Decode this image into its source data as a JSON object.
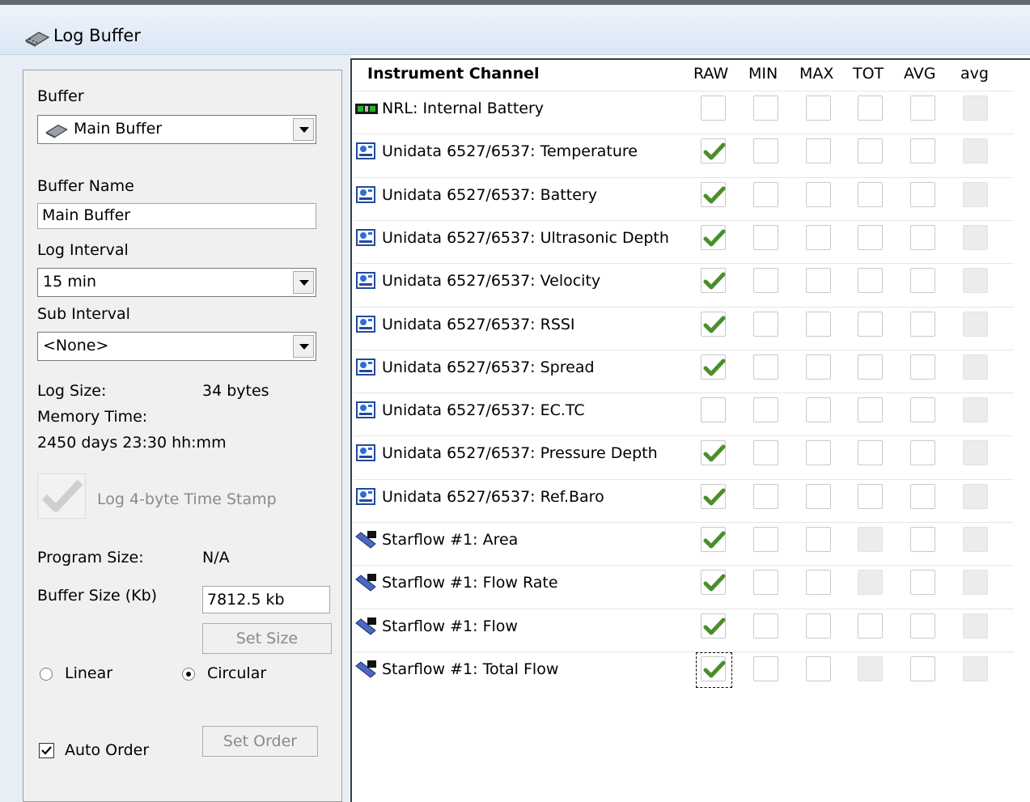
{
  "window": {
    "title": "Log Buffer",
    "icon": "memory-chip-icon"
  },
  "left": {
    "buffer_label": "Buffer",
    "buffer_value": "Main Buffer",
    "buffer_name_label": "Buffer Name",
    "buffer_name_value": "Main Buffer",
    "log_interval_label": "Log Interval",
    "log_interval_value": "15 min",
    "sub_interval_label": "Sub Interval",
    "sub_interval_value": "<None>",
    "log_size_label": "Log Size:",
    "log_size_value": "34 bytes",
    "memory_time_label": "Memory Time:",
    "memory_time_value": "2450 days 23:30 hh:mm",
    "timestamp_label": "Log 4-byte Time Stamp",
    "program_size_label": "Program Size:",
    "program_size_value": "N/A",
    "buffer_size_label": "Buffer Size (Kb)",
    "buffer_size_value": "7812.5 kb",
    "set_size_label": "Set Size",
    "linear_label": "Linear",
    "circular_label": "Circular",
    "auto_order_label": "Auto Order",
    "set_order_label": "Set Order",
    "mode_selected": "Circular",
    "auto_order_checked": true,
    "timestamp_checked": true
  },
  "table": {
    "headers": [
      "Instrument Channel",
      "RAW",
      "MIN",
      "MAX",
      "TOT",
      "AVG",
      "avg"
    ],
    "rows": [
      {
        "label": "NRL: Internal Battery",
        "icon": "battery-board-icon",
        "states": [
          "off",
          "off",
          "off",
          "off",
          "off",
          "dis"
        ]
      },
      {
        "label": "Unidata 6527/6537: Temperature",
        "icon": "instrument-icon",
        "states": [
          "on",
          "off",
          "off",
          "off",
          "off",
          "dis"
        ]
      },
      {
        "label": "Unidata 6527/6537: Battery",
        "icon": "instrument-icon",
        "states": [
          "on",
          "off",
          "off",
          "off",
          "off",
          "dis"
        ]
      },
      {
        "label": "Unidata 6527/6537: Ultrasonic Depth",
        "icon": "instrument-icon",
        "states": [
          "on",
          "off",
          "off",
          "off",
          "off",
          "dis"
        ]
      },
      {
        "label": "Unidata 6527/6537: Velocity",
        "icon": "instrument-icon",
        "states": [
          "on",
          "off",
          "off",
          "off",
          "off",
          "dis"
        ]
      },
      {
        "label": "Unidata 6527/6537: RSSI",
        "icon": "instrument-icon",
        "states": [
          "on",
          "off",
          "off",
          "off",
          "off",
          "dis"
        ]
      },
      {
        "label": "Unidata 6527/6537: Spread",
        "icon": "instrument-icon",
        "states": [
          "on",
          "off",
          "off",
          "off",
          "off",
          "dis"
        ]
      },
      {
        "label": "Unidata 6527/6537: EC.TC",
        "icon": "instrument-icon",
        "states": [
          "off",
          "off",
          "off",
          "off",
          "off",
          "dis"
        ]
      },
      {
        "label": "Unidata 6527/6537: Pressure Depth",
        "icon": "instrument-icon",
        "states": [
          "on",
          "off",
          "off",
          "off",
          "off",
          "dis"
        ]
      },
      {
        "label": "Unidata 6527/6537: Ref.Baro",
        "icon": "instrument-icon",
        "states": [
          "on",
          "off",
          "off",
          "off",
          "off",
          "dis"
        ]
      },
      {
        "label": "Starflow #1: Area",
        "icon": "starflow-probe-icon",
        "states": [
          "on",
          "off",
          "off",
          "dis",
          "off",
          "dis"
        ]
      },
      {
        "label": "Starflow #1: Flow Rate",
        "icon": "starflow-probe-icon",
        "states": [
          "on",
          "off",
          "off",
          "dis",
          "off",
          "dis"
        ]
      },
      {
        "label": "Starflow #1: Flow",
        "icon": "starflow-probe-icon",
        "states": [
          "on",
          "off",
          "off",
          "off",
          "off",
          "dis"
        ]
      },
      {
        "label": "Starflow #1: Total Flow",
        "icon": "starflow-probe-icon",
        "states": [
          "on",
          "off",
          "off",
          "dis",
          "off",
          "dis"
        ]
      }
    ]
  },
  "colors": {
    "check": "#4a8f2a",
    "title_bar": "#dbe7f5",
    "panel": "#f0f0f0"
  }
}
